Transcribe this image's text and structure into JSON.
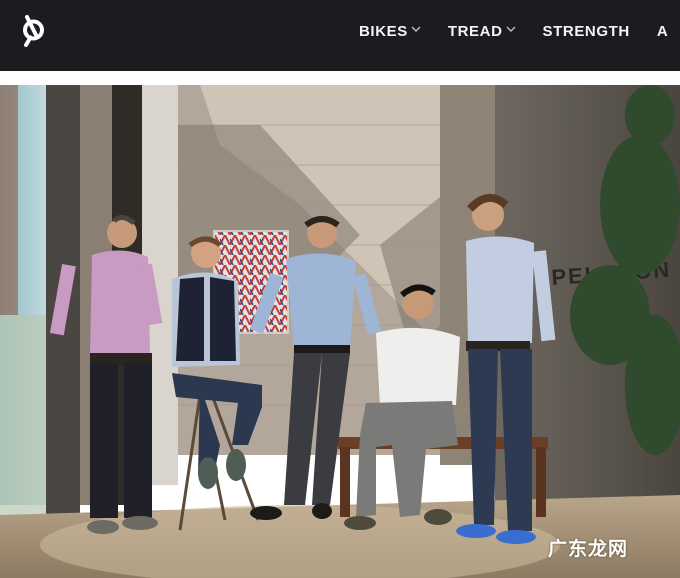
{
  "nav": {
    "logo_icon": "peloton-logo-icon",
    "items": [
      {
        "label": "BIKES",
        "has_dropdown": true
      },
      {
        "label": "TREAD",
        "has_dropdown": true
      },
      {
        "label": "STRENGTH",
        "has_dropdown": false
      },
      {
        "label": "A",
        "has_dropdown": false
      }
    ]
  },
  "hero": {
    "wall_sign": "PELOTON"
  },
  "watermark": "广东龙网",
  "colors": {
    "nav_background": "#1a1c20",
    "nav_text": "#f4f4f4",
    "page_background": "#ffffff"
  }
}
